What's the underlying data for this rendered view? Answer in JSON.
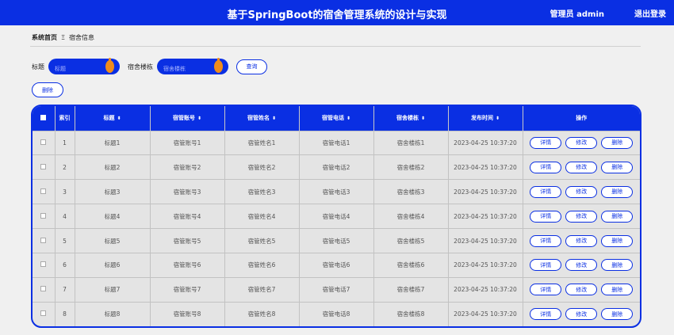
{
  "header": {
    "title": "基于SpringBoot的宿舍管理系统的设计与实现",
    "user": "管理员 admin",
    "logout": "退出登录"
  },
  "breadcrumb": {
    "home": "系统首页",
    "separator": "Ξ",
    "current": "宿舍信息"
  },
  "search": {
    "title_label": "标题",
    "title_placeholder": "标题",
    "building_label": "宿舍楼栋",
    "building_placeholder": "宿舍楼栋",
    "query_label": "查询"
  },
  "toolbar": {
    "delete_label": "删除"
  },
  "table": {
    "columns": [
      "索引",
      "标题",
      "宿管账号",
      "宿管姓名",
      "宿管电话",
      "宿舍楼栋",
      "发布时间",
      "操作"
    ],
    "action_labels": {
      "detail": "详情",
      "edit": "修改",
      "delete": "删除"
    },
    "rows": [
      {
        "index": "1",
        "title": "标题1",
        "account": "宿管账号1",
        "name": "宿管姓名1",
        "phone": "宿管电话1",
        "building": "宿舍楼栋1",
        "time": "2023-04-25 10:37:20"
      },
      {
        "index": "2",
        "title": "标题2",
        "account": "宿管账号2",
        "name": "宿管姓名2",
        "phone": "宿管电话2",
        "building": "宿舍楼栋2",
        "time": "2023-04-25 10:37:20"
      },
      {
        "index": "3",
        "title": "标题3",
        "account": "宿管账号3",
        "name": "宿管姓名3",
        "phone": "宿管电话3",
        "building": "宿舍楼栋3",
        "time": "2023-04-25 10:37:20"
      },
      {
        "index": "4",
        "title": "标题4",
        "account": "宿管账号4",
        "name": "宿管姓名4",
        "phone": "宿管电话4",
        "building": "宿舍楼栋4",
        "time": "2023-04-25 10:37:20"
      },
      {
        "index": "5",
        "title": "标题5",
        "account": "宿管账号5",
        "name": "宿管姓名5",
        "phone": "宿管电话5",
        "building": "宿舍楼栋5",
        "time": "2023-04-25 10:37:20"
      },
      {
        "index": "6",
        "title": "标题6",
        "account": "宿管账号6",
        "name": "宿管姓名6",
        "phone": "宿管电话6",
        "building": "宿舍楼栋6",
        "time": "2023-04-25 10:37:20"
      },
      {
        "index": "7",
        "title": "标题7",
        "account": "宿管账号7",
        "name": "宿管姓名7",
        "phone": "宿管电话7",
        "building": "宿舍楼栋7",
        "time": "2023-04-25 10:37:20"
      },
      {
        "index": "8",
        "title": "标题8",
        "account": "宿管账号8",
        "name": "宿管姓名8",
        "phone": "宿管电话8",
        "building": "宿舍楼栋8",
        "time": "2023-04-25 10:37:20"
      }
    ]
  },
  "colors": {
    "accent": "#0a2fe3",
    "knob": "#f08c1a",
    "background": "#f0f0f0"
  },
  "icons": {
    "sort": "sort-icon",
    "search_knob": "knob-icon",
    "checkbox": "checkbox"
  }
}
